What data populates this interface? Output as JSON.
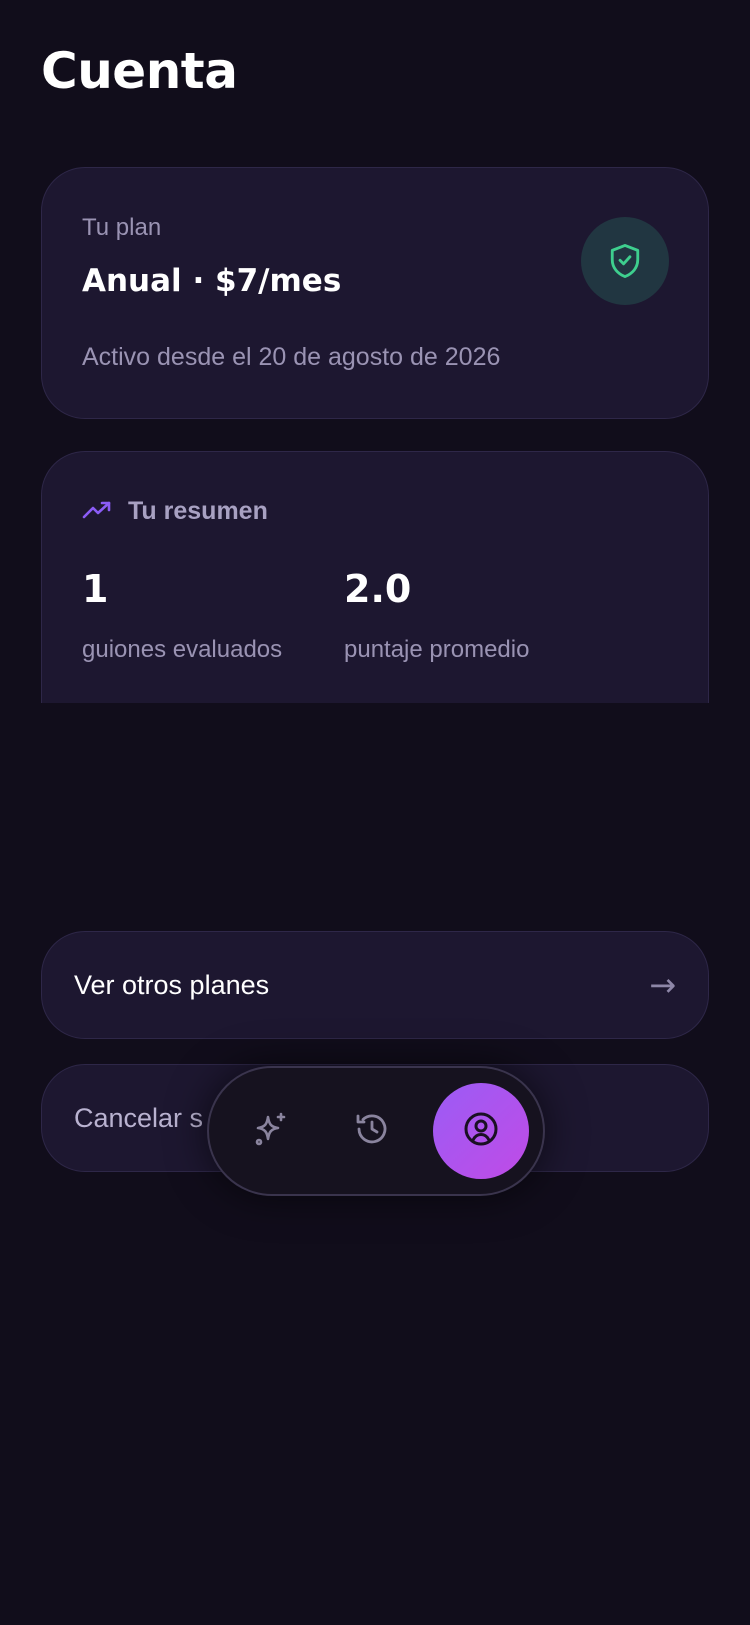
{
  "page": {
    "title": "Cuenta"
  },
  "plan": {
    "label": "Tu plan",
    "name": "Anual · $7/mes",
    "since": "Activo desde el 20 de agosto de 2026",
    "icon": "shield-check-icon",
    "accent_color": "#3ecf8e"
  },
  "summary": {
    "title": "Tu resumen",
    "icon": "trending-up-icon",
    "stats": [
      {
        "value": "1",
        "label": "guiones evaluados"
      },
      {
        "value": "2.0",
        "label": "puntaje promedio"
      }
    ]
  },
  "actions": {
    "other_plans_label": "Ver otros planes",
    "other_plans_arrow": "→",
    "cancel_label": "Cancelar s"
  },
  "tabbar": {
    "tabs": [
      {
        "name": "generate",
        "icon": "sparkles-icon",
        "active": false
      },
      {
        "name": "history",
        "icon": "history-icon",
        "active": false
      },
      {
        "name": "account",
        "icon": "user-circle-icon",
        "active": true
      }
    ],
    "active_gradient": [
      "#9b5cf5",
      "#c04be6"
    ]
  }
}
